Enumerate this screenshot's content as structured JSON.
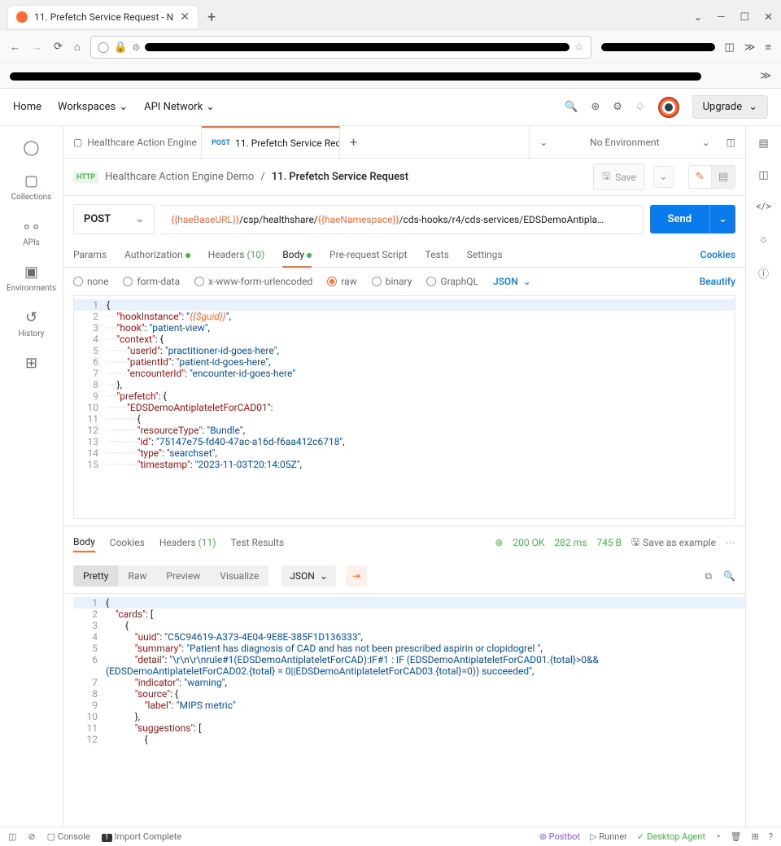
{
  "browser": {
    "tab_title": "11. Prefetch Service Request - N",
    "window": {
      "min": "—",
      "max": "☐",
      "close": "✕",
      "chev": "⌄"
    }
  },
  "pm_header": {
    "home": "Home",
    "workspaces": "Workspaces",
    "api_network": "API Network",
    "upgrade": "Upgrade"
  },
  "sidebar": {
    "items": [
      {
        "label": "Collections"
      },
      {
        "label": "APIs"
      },
      {
        "label": "Environments"
      },
      {
        "label": "History"
      }
    ]
  },
  "tabs": {
    "tab1": "Healthcare Action Engine",
    "tab2_method": "POST",
    "tab2_title": "11. Prefetch Service Req",
    "env": "No Environment"
  },
  "breadcrumb": {
    "badge": "HTTP",
    "parent": "Healthcare Action Engine Demo",
    "current": "11. Prefetch Service Request",
    "save": "Save"
  },
  "url_bar": {
    "method": "POST",
    "var1": "{{haeBaseURL}}",
    "seg1": "/csp/healthshare/",
    "var2": "{{haeNamespace}}",
    "seg2": "/cds-hooks/r4/cds-services/EDSDemoAntipla…",
    "send": "Send"
  },
  "req_tabs": {
    "params": "Params",
    "auth": "Authorization",
    "headers": "Headers",
    "headers_count": "(10)",
    "body": "Body",
    "prereq": "Pre-request Script",
    "tests": "Tests",
    "settings": "Settings",
    "cookies": "Cookies"
  },
  "body_type": {
    "none": "none",
    "formdata": "form-data",
    "xwww": "x-www-form-urlencoded",
    "raw": "raw",
    "binary": "binary",
    "graphql": "GraphQL",
    "lang": "JSON",
    "beautify": "Beautify"
  },
  "request_body": {
    "l1": "{",
    "l2_k": "\"hookInstance\"",
    "l2_v": "\"{{$guid}}\"",
    "l3_k": "\"hook\"",
    "l3_v": "\"patient-view\"",
    "l4_k": "\"context\"",
    "l5_k": "\"userId\"",
    "l5_v": "\"practitioner-id-goes-here\"",
    "l6_k": "\"patientId\"",
    "l6_v": "\"patient-id-goes-here\"",
    "l7_k": "\"encounterId\"",
    "l7_v": "\"encounter-id-goes-here\"",
    "l9_k": "\"prefetch\"",
    "l10_k": "\"EDSDemoAntiplateletForCAD01\"",
    "l12_k": "\"resourceType\"",
    "l12_v": "\"Bundle\"",
    "l13_k": "\"id\"",
    "l13_v": "\"75147e75-fd40-47ac-a16d-f6aa412c6718\"",
    "l14_k": "\"type\"",
    "l14_v": "\"searchset\"",
    "l15_k": "\"timestamp\"",
    "l15_v": "\"2023-11-03T20:14:05Z\""
  },
  "response_bar": {
    "body": "Body",
    "cookies": "Cookies",
    "headers": "Headers",
    "headers_count": "(11)",
    "tests": "Test Results",
    "status": "200 OK",
    "time": "282 ms",
    "size": "745 B",
    "save_example": "Save as example"
  },
  "resp_view": {
    "pretty": "Pretty",
    "raw": "Raw",
    "preview": "Preview",
    "visualize": "Visualize",
    "format": "JSON"
  },
  "response_body": {
    "l1": "{",
    "l2_k": "\"cards\"",
    "l4_k": "\"uuid\"",
    "l4_v": "\"C5C94619-A373-4E04-9E8E-385F1D136333\"",
    "l5_k": "\"summary\"",
    "l5_v": "\"Patient has diagnosis of CAD and has not been prescribed aspirin or clopidogrel \"",
    "l6_k": "\"detail\"",
    "l6_v": "\"\\r\\n\\r\\nrule#1(EDSDemoAntiplateletForCAD):IF#1 : IF (EDSDemoAntiplateletForCAD01.{total}>0&&(EDSDemoAntiplateletForCAD02.{total} = 0||EDSDemoAntiplateletForCAD03.{total}=0)) succeeded\"",
    "l7_k": "\"indicator\"",
    "l7_v": "\"warning\"",
    "l8_k": "\"source\"",
    "l9_k": "\"label\"",
    "l9_v": "\"MIPS metric\"",
    "l11_k": "\"suggestions\""
  },
  "footer": {
    "console": "Console",
    "import": "Import Complete",
    "postbot": "Postbot",
    "runner": "Runner",
    "agent": "Desktop Agent"
  }
}
